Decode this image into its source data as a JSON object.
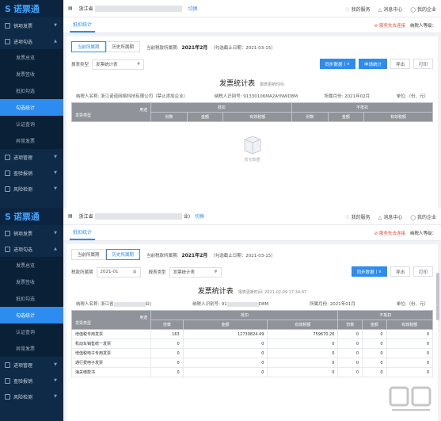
{
  "shot1": {
    "logo": "诺票通",
    "nav": {
      "groups": [
        "销项发票",
        "进项勾选",
        "进项管理",
        "查验报销",
        "风险检测"
      ],
      "subs": [
        "发票总览",
        "发票签收",
        "抵扣勾选",
        "勾选统计",
        "认证查询",
        "异常发票"
      ]
    },
    "topbar": {
      "company_prefix": "浙江省",
      "company_suffix": "",
      "switch": "切换",
      "service": "我的服务",
      "messages": "消息中心",
      "mycompany": "我的企业"
    },
    "tab": "抵扣统计",
    "tab_right": {
      "risk": "服务失去连接",
      "taxpayer": "纳税人等级："
    },
    "subtabs": [
      "当前所属期",
      "历史所属期"
    ],
    "period_label": "当前税款所属期:",
    "period_value": "2021年2月",
    "period_note": "（勾选截止日期：2021-03-15）",
    "filter_label": "报表类型",
    "filter_value": "发票统计表",
    "buttons": {
      "sync": "同步数据",
      "apply": "申请统计",
      "export": "导出",
      "print": "打印"
    },
    "report_title": "发票统计表",
    "report_note": "报表更新时间:",
    "info": {
      "name_label": "纳税人名称:",
      "name": "浙江诺诺网络科技有限公司（禁止添加企业）",
      "id_label": "纳税人识别号:",
      "id": "91330106MA2AYNWD8M",
      "month_label": "所属月份:",
      "month": "2021年02月",
      "unit": "单位:（份、元）"
    },
    "table_head": {
      "purpose": "用途",
      "type": "发票类型",
      "deductible": "抵扣",
      "nondeductible": "不抵扣",
      "count": "份数",
      "amount": "金额",
      "tax": "有效税额"
    },
    "empty": "暂无数据"
  },
  "shot2": {
    "logo": "诺票通",
    "nav": {
      "groups": [
        "销项发票",
        "进项勾选",
        "进项管理",
        "查验报销",
        "风险检测"
      ],
      "subs": [
        "发票总览",
        "发票签收",
        "抵扣勾选",
        "勾选统计",
        "认证查询",
        "异常发票"
      ]
    },
    "topbar": {
      "company_prefix": "浙江省",
      "company_suffix": "业)",
      "switch": "切换",
      "service": "我的服务",
      "messages": "消息中心",
      "mycompany": "我的企业"
    },
    "tab": "抵扣统计",
    "tab_right": {
      "risk": "服务失去连接",
      "taxpayer": "纳税人等级："
    },
    "subtabs": [
      "当前所属期",
      "历史所属期"
    ],
    "period_label": "当前税款所属期:",
    "period_value": "2021年2月",
    "period_note": "（勾选截止日期：2021-03-15）",
    "filter_label": "税款所属期",
    "filter_date": "2021-01",
    "filter_label2": "报表类型",
    "filter_value": "发票统计表",
    "buttons": {
      "sync": "同步数据",
      "export": "导出",
      "print": "打印"
    },
    "report_title": "发票统计表",
    "report_note": "报表更新时间:  2021-02-09 17:34:47",
    "info": {
      "name_label": "纳税人名称:",
      "name_prefix": "浙江省",
      "name_suffix": "业)",
      "id_label": "纳税人识别号:",
      "id_prefix": "91",
      "id_suffix": "D8M",
      "month_label": "所属月份:",
      "month": "2021年01月",
      "unit": "单位:（份、元）"
    },
    "table_head": {
      "purpose": "用途",
      "type": "发票类型",
      "deductible": "抵扣",
      "nondeductible": "不抵扣",
      "count": "份数",
      "amount": "金额",
      "tax": "有效税额"
    },
    "rows": [
      [
        "增值税专用发票",
        "163",
        "12739824.49",
        "759670.26",
        "0",
        "0",
        "0"
      ],
      [
        "机动车销售统一发票",
        "0",
        "0",
        "0",
        "0",
        "0",
        "0"
      ],
      [
        "增值税电子专用发票",
        "0",
        "0",
        "0",
        "0",
        "0",
        "0"
      ],
      [
        "通行费电子发票",
        "0",
        "0",
        "0",
        "0",
        "0",
        "0"
      ],
      [
        "海关缴款书",
        "0",
        "0",
        "0",
        "0",
        "0",
        "0"
      ]
    ]
  },
  "colors": {
    "sidebar": "#0e2a47",
    "accent": "#2d8cf0",
    "header": "#909399"
  }
}
